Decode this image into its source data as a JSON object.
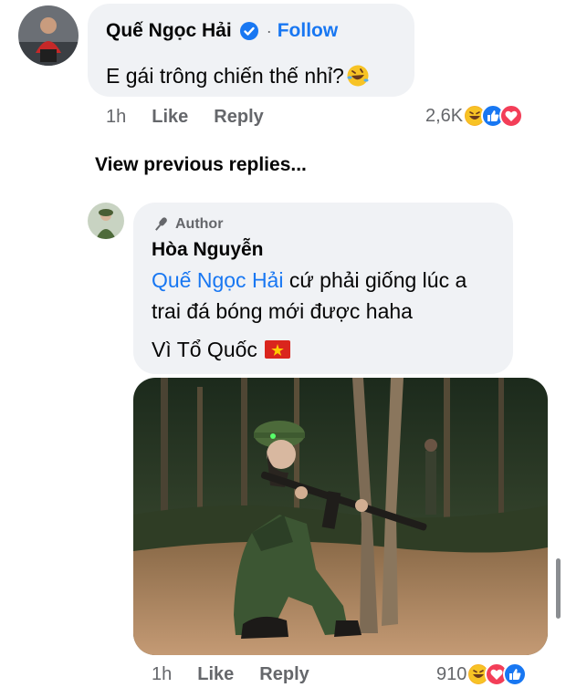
{
  "comment1": {
    "author": "Quế Ngọc Hải",
    "separator": "·",
    "follow_label": "Follow",
    "text": "E gái trông chiến thế nhỉ?",
    "time": "1h",
    "like_label": "Like",
    "reply_label": "Reply",
    "reaction_count": "2,6K",
    "reactions": [
      "haha-icon",
      "like-icon",
      "love-icon"
    ]
  },
  "view_previous_replies": "View previous replies...",
  "comment2": {
    "badge_label": "Author",
    "author": "Hòa Nguyễn",
    "mention": "Quế Ngọc Hải",
    "text_line1_rest": " cứ phải giống lúc a",
    "text_line2": "trai đá bóng mới được haha",
    "text_line3": "Vì Tổ Quốc",
    "time": "1h",
    "like_label": "Like",
    "reply_label": "Reply",
    "reaction_count": "910",
    "reactions": [
      "haha-icon",
      "love-icon",
      "like-icon"
    ]
  },
  "colors": {
    "link": "#1877f2",
    "bubble": "#f0f2f5",
    "meta": "#65676b",
    "like": "#1877f2",
    "love": "#f33e58",
    "haha": "#f7b125"
  }
}
